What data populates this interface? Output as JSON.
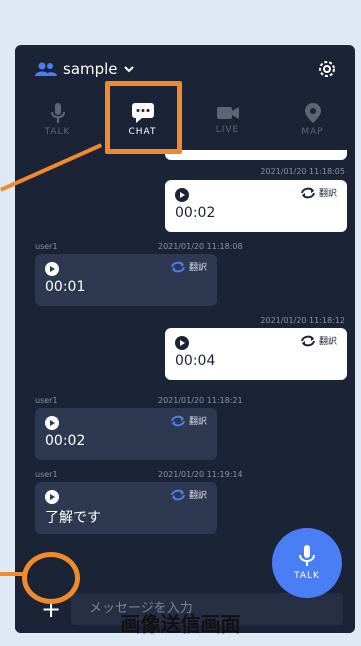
{
  "header": {
    "username": "sample"
  },
  "tabs": [
    {
      "label": "TALK"
    },
    {
      "label": "CHAT"
    },
    {
      "label": "LIVE"
    },
    {
      "label": "MAP"
    }
  ],
  "messages": [
    {
      "sender": "",
      "time": "2021/01/20 11:18:05",
      "duration": "00:02",
      "translate": "翻訳",
      "side": "me"
    },
    {
      "sender": "user1",
      "time": "2021/01/20 11:18:08",
      "duration": "00:01",
      "translate": "翻訳",
      "side": "other"
    },
    {
      "sender": "",
      "time": "2021/01/20 11:18:12",
      "duration": "00:04",
      "translate": "翻訳",
      "side": "me"
    },
    {
      "sender": "user1",
      "time": "2021/01/20 11:18:21",
      "duration": "00:02",
      "translate": "翻訳",
      "side": "other"
    },
    {
      "sender": "user1",
      "time": "2021/01/20 11:19:14",
      "duration": "",
      "text": "了解です",
      "translate": "翻訳",
      "side": "other"
    }
  ],
  "footer": {
    "placeholder": "メッセージを入力",
    "talk_label": "TALK"
  },
  "caption": "画像送信画面",
  "colors": {
    "background": "#1b2336",
    "accent": "#4a7ef5",
    "highlight": "#f08a2a"
  }
}
